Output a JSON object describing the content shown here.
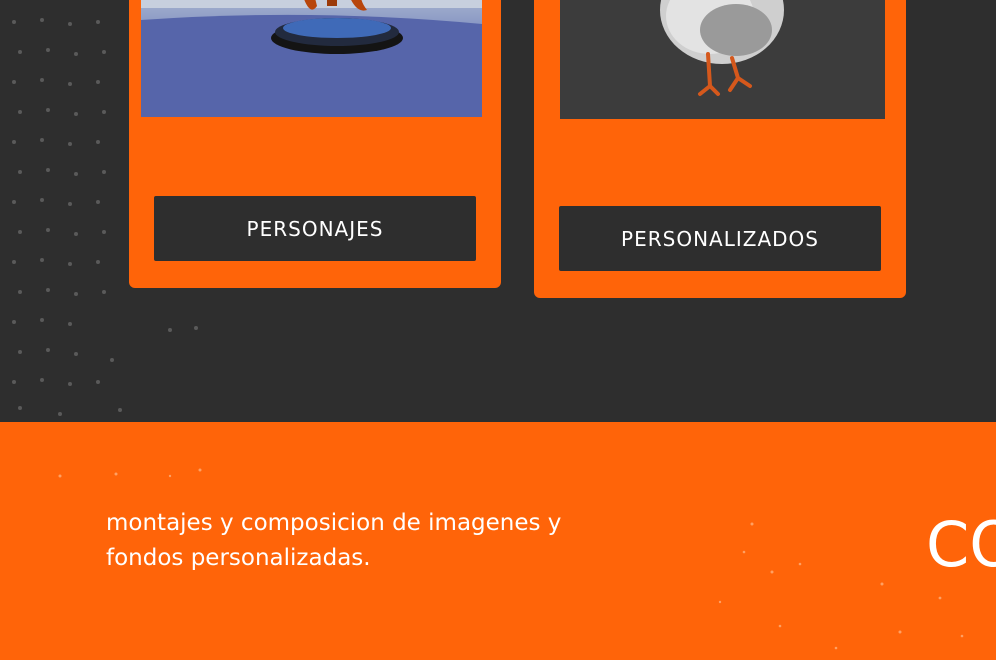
{
  "cards": [
    {
      "button_label": "PERSONAJES"
    },
    {
      "button_label": "PERSONALIZADOS"
    }
  ],
  "banner": {
    "description_line1": "montajes y composicion de imagenes y",
    "description_line2": "fondos personalizadas.",
    "heading_fragment": "CO"
  },
  "colors": {
    "dark_background": "#2e2e2e",
    "accent_orange": "#ff6409",
    "button_text": "#ffffff"
  }
}
